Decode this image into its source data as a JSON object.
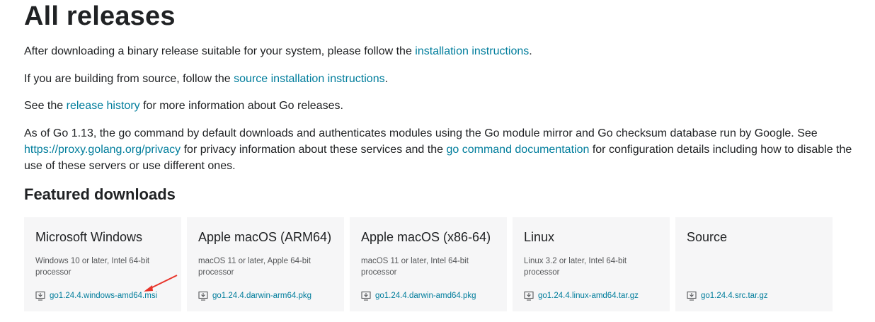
{
  "heading": "All releases",
  "intro": {
    "p1_before": "After downloading a binary release suitable for your system, please follow the ",
    "p1_link": "installation instructions",
    "p1_after": ".",
    "p2_before": "If you are building from source, follow the ",
    "p2_link": "source installation instructions",
    "p2_after": ".",
    "p3_before": "See the ",
    "p3_link": "release history",
    "p3_after": " for more information about Go releases.",
    "p4_before": "As of Go 1.13, the go command by default downloads and authenticates modules using the Go module mirror and Go checksum database run by Google. See ",
    "p4_link1": "https://proxy.golang.org/privacy",
    "p4_middle": " for privacy information about these services and the ",
    "p4_link2": "go command documentation",
    "p4_after": " for configuration details including how to disable the use of these servers or use different ones."
  },
  "featured": {
    "title": "Featured downloads",
    "cards": [
      {
        "os": "Microsoft Windows",
        "desc": "Windows 10 or later, Intel 64-bit processor",
        "file": "go1.24.4.windows-amd64.msi"
      },
      {
        "os": "Apple macOS (ARM64)",
        "desc": "macOS 11 or later, Apple 64-bit processor",
        "file": "go1.24.4.darwin-arm64.pkg"
      },
      {
        "os": "Apple macOS (x86-64)",
        "desc": "macOS 11 or later, Intel 64-bit processor",
        "file": "go1.24.4.darwin-amd64.pkg"
      },
      {
        "os": "Linux",
        "desc": "Linux 3.2 or later, Intel 64-bit processor",
        "file": "go1.24.4.linux-amd64.tar.gz"
      },
      {
        "os": "Source",
        "desc": "",
        "file": "go1.24.4.src.tar.gz"
      }
    ]
  },
  "colors": {
    "link": "#007d9c",
    "text": "#202224",
    "card_bg": "#f6f6f7",
    "annotation_arrow": "#e8342a"
  },
  "icons": {
    "download": "download-icon",
    "annotation": "red-arrow-annotation"
  }
}
